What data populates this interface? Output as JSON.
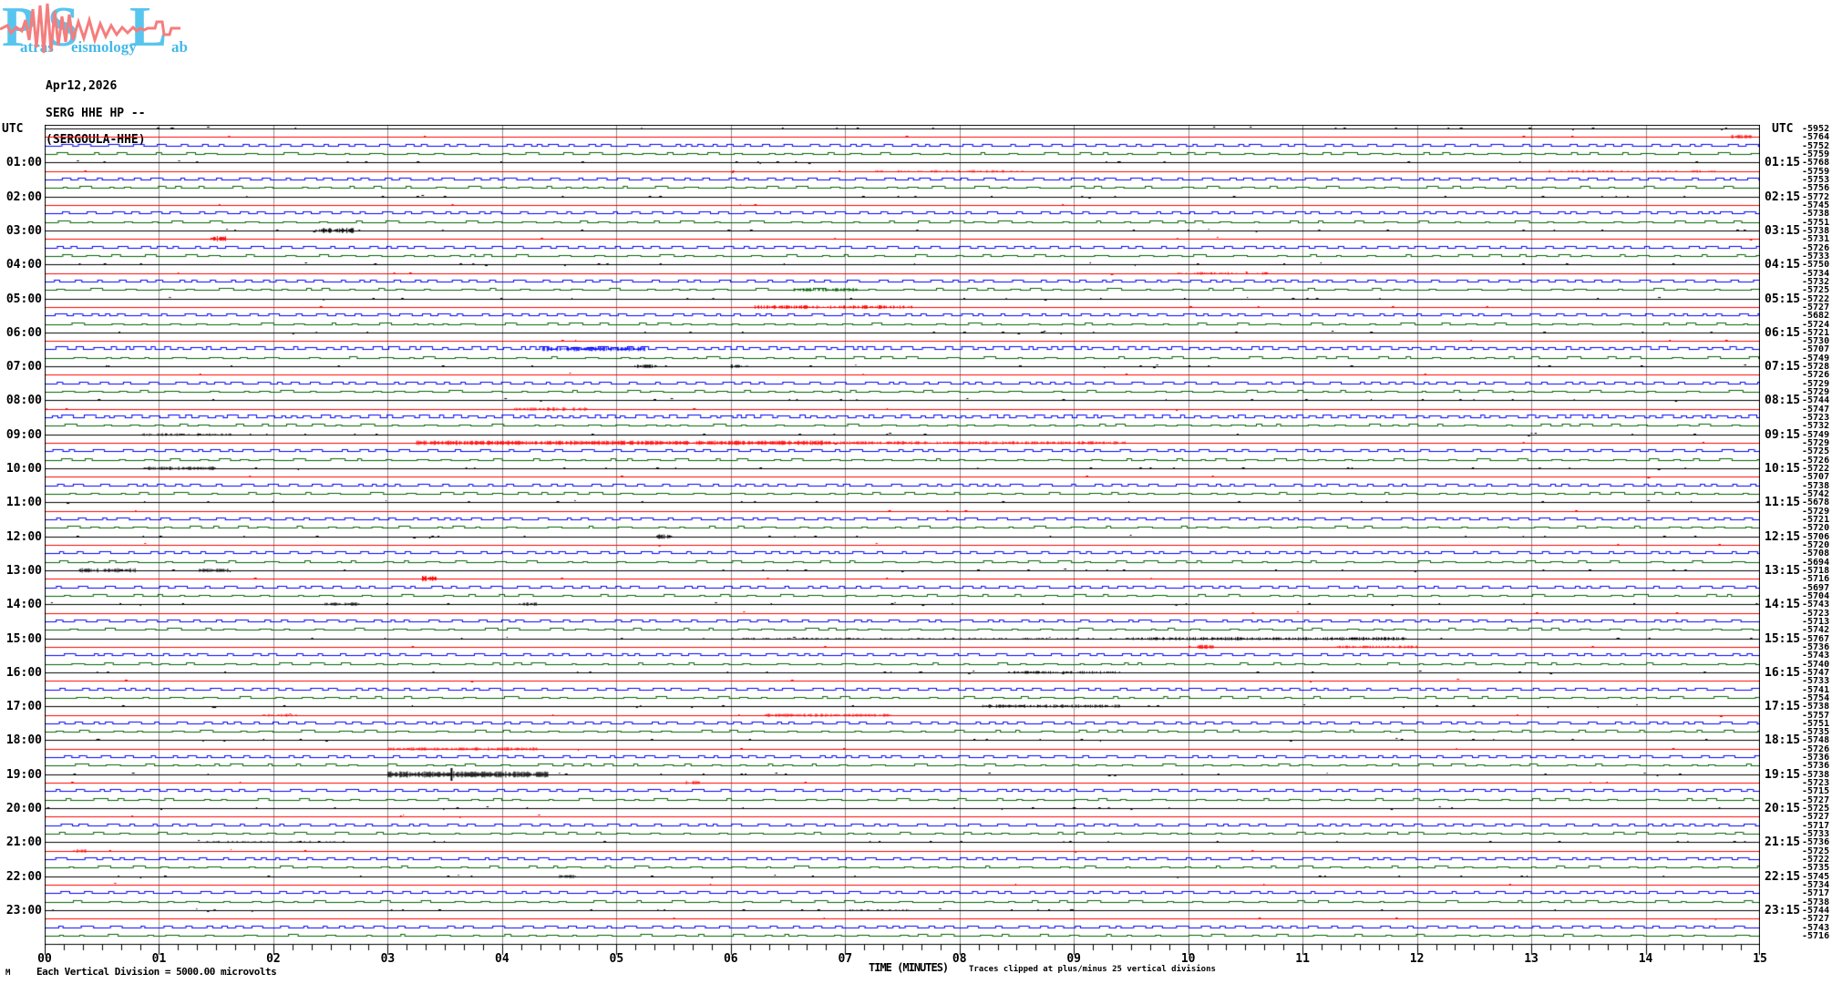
{
  "logo": {
    "letters": [
      "P",
      "S",
      "L"
    ],
    "sub_words": [
      "atras",
      "eismology",
      "ab"
    ],
    "letter_color": "#58c5ee",
    "wave_color": "#f57d7d"
  },
  "header": {
    "date": "Apr12,2026",
    "station": "SERG HHE HP --",
    "station_name": "(SERGOULA-HHE)"
  },
  "axis": {
    "utc_left": "UTC",
    "utc_right": "UTC",
    "left_labels": [
      "01:00",
      "02:00",
      "03:00",
      "04:00",
      "05:00",
      "06:00",
      "07:00",
      "08:00",
      "09:00",
      "10:00",
      "11:00",
      "12:00",
      "13:00",
      "14:00",
      "15:00",
      "16:00",
      "17:00",
      "18:00",
      "19:00",
      "20:00",
      "21:00",
      "22:00",
      "23:00"
    ],
    "right_labels": [
      "01:15",
      "02:15",
      "03:15",
      "04:15",
      "05:15",
      "06:15",
      "07:15",
      "08:15",
      "09:15",
      "10:15",
      "11:15",
      "12:15",
      "13:15",
      "14:15",
      "15:15",
      "16:15",
      "17:15",
      "18:15",
      "19:15",
      "20:15",
      "21:15",
      "22:15",
      "23:15"
    ],
    "x_ticks": [
      "00",
      "01",
      "02",
      "03",
      "04",
      "05",
      "06",
      "07",
      "08",
      "09",
      "10",
      "11",
      "12",
      "13",
      "14",
      "15"
    ],
    "xlabel": "TIME (MINUTES)",
    "clip_note": "Traces clipped at plus/minus 25 vertical divisions",
    "scale_note": "Each Vertical Division = 5000.00 microvolts",
    "corner_artifact": "M"
  },
  "chart_data": {
    "type": "line",
    "subtype": "helicorder-seismogram",
    "title": "SERG HHE HP -- (SERGOULA-HHE) Apr12,2026",
    "x_unit": "minutes",
    "x_range": [
      0,
      15
    ],
    "minutes_per_row": 15,
    "rows_per_hour": 4,
    "hours": 24,
    "trace_color_cycle": [
      "#000000",
      "#ff0000",
      "#0000ff",
      "#006400"
    ],
    "grid_color": "#8c8c8c",
    "vertical_division_microvolts": "5000.00",
    "clip_divisions": 25,
    "row_offsets_microvolts": [
      -5952,
      -5764,
      -5752,
      -5759,
      -5768,
      -5759,
      -5753,
      -5756,
      -5772,
      -5745,
      -5738,
      -5751,
      -5738,
      -5731,
      -5726,
      -5733,
      -5750,
      -5734,
      -5732,
      -5725,
      -5722,
      -5727,
      -5682,
      -5724,
      -5721,
      -5730,
      -5707,
      -5749,
      -5728,
      -5726,
      -5729,
      -5729,
      -5744,
      -5747,
      -5723,
      -5732,
      -5749,
      -5729,
      -5725,
      -5726,
      -5722,
      -5707,
      -5738,
      -5742,
      -5678,
      -5729,
      -5721,
      -5720,
      -5706,
      -5720,
      -5708,
      -5694,
      -5718,
      -5716,
      -5697,
      -5704,
      -5743,
      -5723,
      -5713,
      -5742,
      -5767,
      -5736,
      -5743,
      -5740,
      -5747,
      -5733,
      -5741,
      -5754,
      -5738,
      -5757,
      -5751,
      -5735,
      -5748,
      -5726,
      -5736,
      -5736,
      -5738,
      -5723,
      -5715,
      -5727,
      -5725,
      -5727,
      -5717,
      -5733,
      -5736,
      -5725,
      -5722,
      -5735,
      -5745,
      -5734,
      -5717,
      -5738,
      -5744,
      -5727,
      -5743,
      -5716
    ],
    "strong_ripple_rows": [
      26,
      34
    ],
    "events": [
      {
        "r": 1,
        "m0": 14.75,
        "m1": 14.92,
        "a": 2,
        "d": 0.8
      },
      {
        "r": 5,
        "m0": 7.2,
        "m1": 8.6,
        "a": 1.5,
        "d": 0.22
      },
      {
        "r": 5,
        "m0": 13.1,
        "m1": 14.6,
        "a": 1.5,
        "d": 0.2
      },
      {
        "r": 12,
        "m0": 2.4,
        "m1": 2.7,
        "a": 3,
        "d": 0.8
      },
      {
        "r": 13,
        "m0": 1.45,
        "m1": 1.58,
        "a": 3,
        "d": 0.9
      },
      {
        "r": 17,
        "m0": 9.9,
        "m1": 10.7,
        "a": 1.5,
        "d": 0.3
      },
      {
        "r": 19,
        "m0": 6.55,
        "m1": 7.1,
        "a": 2,
        "d": 0.7
      },
      {
        "r": 21,
        "m0": 6.2,
        "m1": 7.6,
        "a": 2,
        "d": 0.5
      },
      {
        "r": 26,
        "m0": 4.35,
        "m1": 5.25,
        "a": 2.5,
        "d": 0.7
      },
      {
        "r": 28,
        "m0": 5.15,
        "m1": 5.35,
        "a": 2,
        "d": 0.6
      },
      {
        "r": 28,
        "m0": 6.0,
        "m1": 6.15,
        "a": 2,
        "d": 0.6
      },
      {
        "r": 33,
        "m0": 4.1,
        "m1": 4.75,
        "a": 2,
        "d": 0.6
      },
      {
        "r": 36,
        "m0": 0.85,
        "m1": 1.65,
        "a": 1.5,
        "d": 0.4
      },
      {
        "r": 37,
        "m0": 3.25,
        "m1": 6.9,
        "a": 2.5,
        "d": 0.85
      },
      {
        "r": 37,
        "m0": 6.9,
        "m1": 9.45,
        "a": 1.8,
        "d": 0.55
      },
      {
        "r": 40,
        "m0": 0.85,
        "m1": 1.5,
        "a": 2,
        "d": 0.7
      },
      {
        "r": 48,
        "m0": 5.35,
        "m1": 5.48,
        "a": 2.5,
        "d": 0.9
      },
      {
        "r": 52,
        "m0": 0.3,
        "m1": 0.8,
        "a": 2.5,
        "d": 0.7
      },
      {
        "r": 52,
        "m0": 1.35,
        "m1": 1.6,
        "a": 2,
        "d": 0.7
      },
      {
        "r": 53,
        "m0": 3.3,
        "m1": 3.42,
        "a": 3,
        "d": 0.9
      },
      {
        "r": 56,
        "m0": 2.45,
        "m1": 2.75,
        "a": 2,
        "d": 0.6
      },
      {
        "r": 56,
        "m0": 4.15,
        "m1": 4.3,
        "a": 2,
        "d": 0.7
      },
      {
        "r": 60,
        "m0": 6.0,
        "m1": 9.5,
        "a": 1.2,
        "d": 0.3
      },
      {
        "r": 60,
        "m0": 9.5,
        "m1": 11.9,
        "a": 1.8,
        "d": 0.6
      },
      {
        "r": 61,
        "m0": 10.08,
        "m1": 10.22,
        "a": 2.5,
        "d": 0.9
      },
      {
        "r": 61,
        "m0": 11.3,
        "m1": 12.0,
        "a": 1.5,
        "d": 0.4
      },
      {
        "r": 64,
        "m0": 8.4,
        "m1": 9.4,
        "a": 1.5,
        "d": 0.5
      },
      {
        "r": 68,
        "m0": 8.2,
        "m1": 9.4,
        "a": 1.8,
        "d": 0.6
      },
      {
        "r": 69,
        "m0": 1.9,
        "m1": 2.2,
        "a": 1.5,
        "d": 0.4
      },
      {
        "r": 69,
        "m0": 6.3,
        "m1": 7.4,
        "a": 1.8,
        "d": 0.6
      },
      {
        "r": 73,
        "m0": 3.0,
        "m1": 4.3,
        "a": 1.8,
        "d": 0.6
      },
      {
        "r": 76,
        "m0": 3.0,
        "m1": 4.4,
        "a": 3.5,
        "d": 0.9,
        "s": [
          3.55,
          7
        ]
      },
      {
        "r": 77,
        "m0": 5.6,
        "m1": 5.72,
        "a": 2,
        "d": 0.7
      },
      {
        "r": 84,
        "m0": 1.4,
        "m1": 2.6,
        "a": 1.2,
        "d": 0.3
      },
      {
        "r": 85,
        "m0": 0.25,
        "m1": 0.38,
        "a": 2,
        "d": 0.8
      },
      {
        "r": 88,
        "m0": 4.5,
        "m1": 4.65,
        "a": 2,
        "d": 0.8
      },
      {
        "r": 92,
        "m0": 7.0,
        "m1": 7.6,
        "a": 1.2,
        "d": 0.3
      }
    ]
  }
}
